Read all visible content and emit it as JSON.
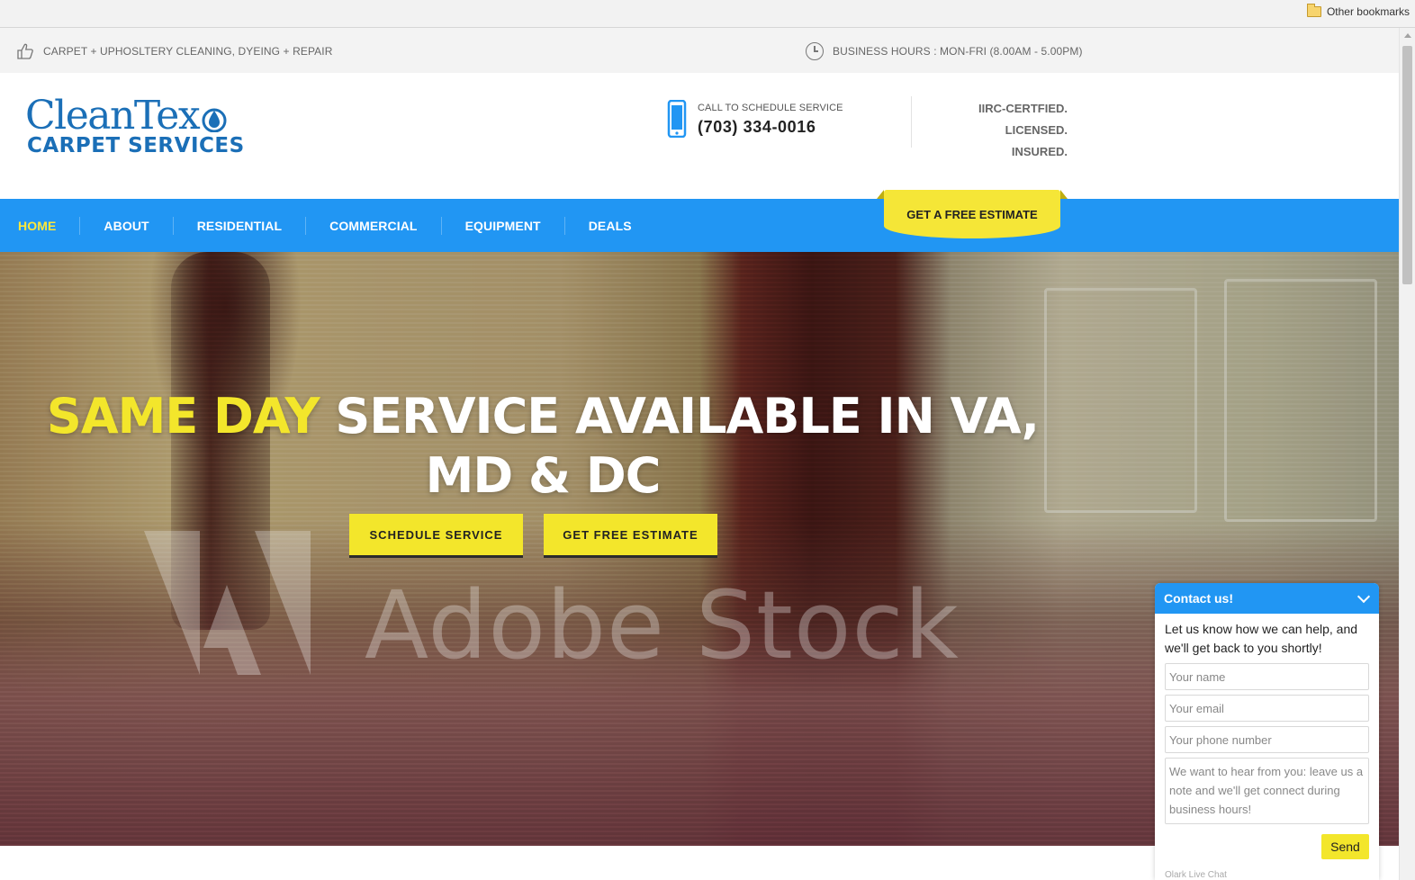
{
  "browser": {
    "other_bookmarks": "Other bookmarks"
  },
  "info_strip": {
    "services": "CARPET + UPHOSLTERY CLEANING, DYEING + REPAIR",
    "hours": "BUSINESS HOURS : MON-FRI (8.00AM - 5.00PM)"
  },
  "header": {
    "logo_top": "CleanTex",
    "logo_bottom": "CARPET SERVICES",
    "call_label": "CALL TO SCHEDULE SERVICE",
    "phone": "(703) 334-0016",
    "cert_line1": "IIRC-CERTFIED. LICENSED.",
    "cert_line2": "INSURED."
  },
  "nav": {
    "items": [
      {
        "label": "HOME",
        "active": true
      },
      {
        "label": "ABOUT"
      },
      {
        "label": "RESIDENTIAL"
      },
      {
        "label": "COMMERCIAL"
      },
      {
        "label": "EQUIPMENT"
      },
      {
        "label": "DEALS"
      }
    ],
    "cta": "GET A FREE ESTIMATE"
  },
  "hero": {
    "headline_highlight": "SAME DAY",
    "headline_rest": " SERVICE AVAILABLE IN VA, MD & DC",
    "watermark": "Adobe Stock",
    "btn_schedule": "SCHEDULE SERVICE",
    "btn_estimate": "GET FREE ESTIMATE"
  },
  "chat": {
    "title": "Contact us!",
    "intro": "Let us know how we can help, and we'll get back to you shortly!",
    "name_placeholder": "Your name",
    "email_placeholder": "Your email",
    "phone_placeholder": "Your phone number",
    "message_placeholder": "We want to hear from you: leave us a note and we'll get connect during business hours!",
    "send": "Send",
    "footer": "Olark Live Chat"
  },
  "colors": {
    "nav_blue": "#2196f3",
    "accent_yellow": "#f3e62b",
    "logo_blue": "#1b6fb7"
  },
  "icons": [
    "folder-icon",
    "thumbs-up-icon",
    "clock-icon",
    "phone-icon",
    "water-drop-icon",
    "chevron-down-icon",
    "adobe-logo-icon"
  ]
}
